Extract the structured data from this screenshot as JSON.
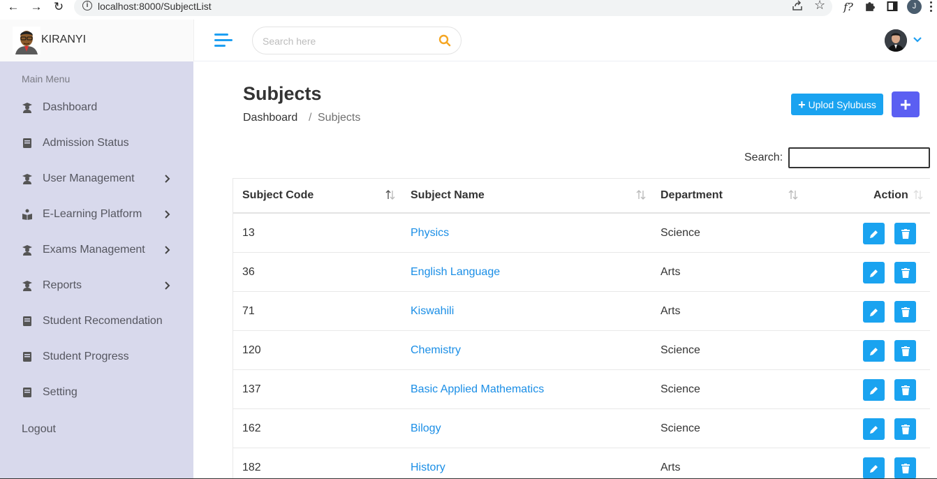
{
  "browser": {
    "url": "localhost:8000/SubjectList",
    "profile_initial": "J",
    "ext_label": "f?"
  },
  "header": {
    "brand_name": "KIRANYI",
    "search_placeholder": "Search here"
  },
  "sidebar": {
    "title": "Main Menu",
    "items": [
      {
        "label": "Dashboard",
        "icon": "graduate-icon",
        "has_arrow": false
      },
      {
        "label": "Admission Status",
        "icon": "book-icon",
        "has_arrow": false
      },
      {
        "label": "User Management",
        "icon": "graduate-icon",
        "has_arrow": true
      },
      {
        "label": "E-Learning Platform",
        "icon": "reader-icon",
        "has_arrow": true
      },
      {
        "label": "Exams Management",
        "icon": "graduate-icon",
        "has_arrow": true
      },
      {
        "label": "Reports",
        "icon": "graduate-icon",
        "has_arrow": true
      },
      {
        "label": "Student Recomendation",
        "icon": "book-icon",
        "has_arrow": false
      },
      {
        "label": "Student Progress",
        "icon": "book-icon",
        "has_arrow": false
      },
      {
        "label": "Setting",
        "icon": "book-icon",
        "has_arrow": false
      }
    ],
    "logout": "Logout"
  },
  "page": {
    "title": "Subjects",
    "breadcrumb_home": "Dashboard",
    "breadcrumb_sep": "/",
    "breadcrumb_current": "Subjects",
    "upload_button": "Uplod Sylubuss",
    "search_label": "Search:"
  },
  "table": {
    "headers": {
      "code": "Subject Code",
      "name": "Subject Name",
      "department": "Department",
      "action": "Action"
    },
    "rows": [
      {
        "code": "13",
        "name": "Physics",
        "department": "Science"
      },
      {
        "code": "36",
        "name": "English Language",
        "department": "Arts"
      },
      {
        "code": "71",
        "name": "Kiswahili",
        "department": "Arts"
      },
      {
        "code": "120",
        "name": "Chemistry",
        "department": "Science"
      },
      {
        "code": "137",
        "name": "Basic Applied Mathematics",
        "department": "Science"
      },
      {
        "code": "162",
        "name": "Bilogy",
        "department": "Science"
      },
      {
        "code": "182",
        "name": "History",
        "department": "Arts"
      }
    ]
  },
  "colors": {
    "accent": "#1aa3f0",
    "primary": "#5b5ff2",
    "sidebar_bg": "#d8d9ec",
    "link": "#1a8ee6"
  }
}
